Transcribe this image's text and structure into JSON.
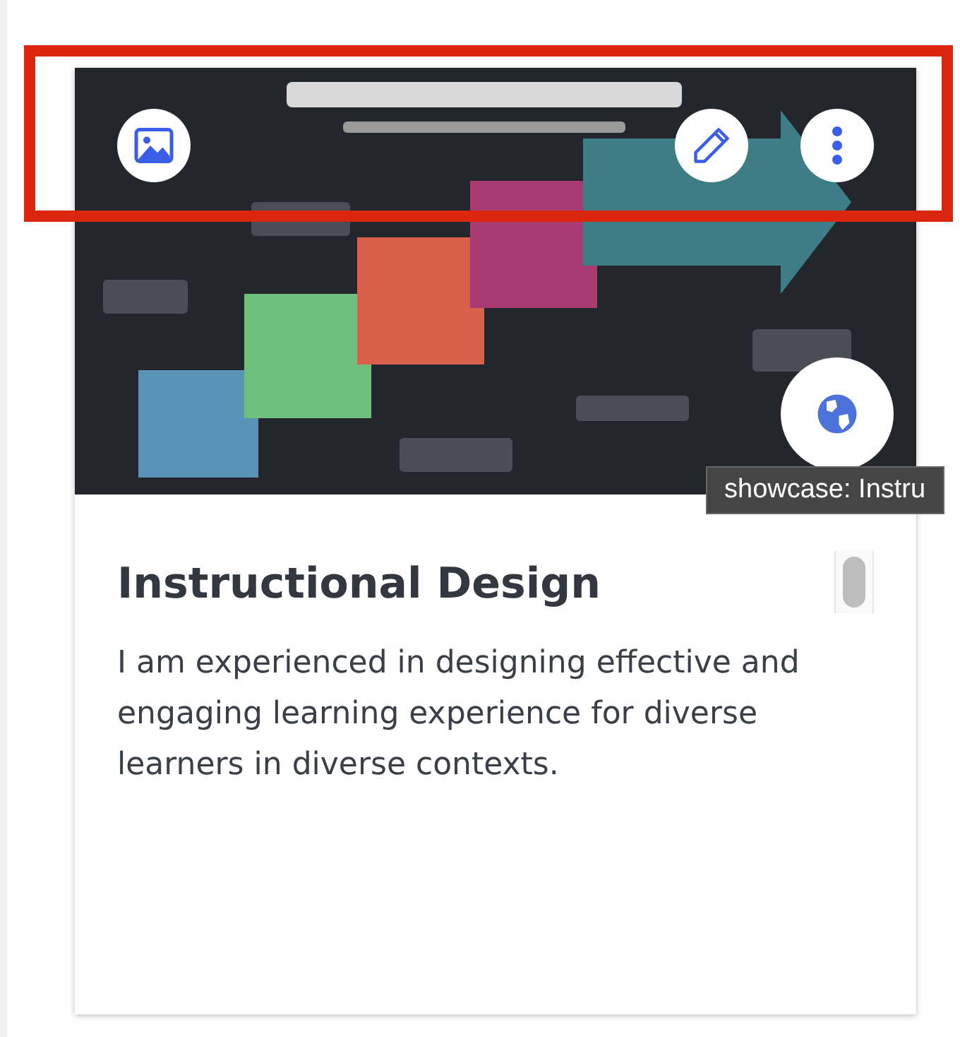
{
  "card": {
    "title": "Instructional Design",
    "description": "I am experienced in designing effective and engaging learning experience for diverse learners in diverse contexts.",
    "tooltip": "showcase: Instru"
  }
}
